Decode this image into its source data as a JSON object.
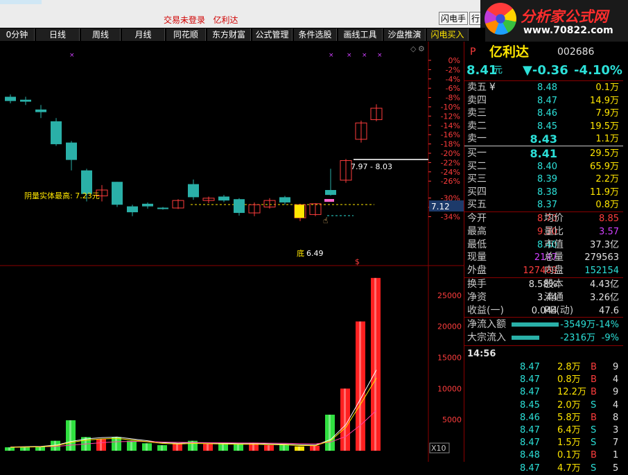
{
  "top": {
    "trade_status": "交易未登录",
    "stock_name": "亿利达",
    "flash_btn": "闪电手",
    "more_btn": "行"
  },
  "logo": {
    "brand": "分析家公式网",
    "url": "www.70822.com"
  },
  "toolbar": {
    "items": [
      "0分钟",
      "日线",
      "周线",
      "月线",
      "同花顺",
      "东方财富",
      "公式管理",
      "条件选股",
      "画线工具",
      "沙盘推演",
      "闪电买入"
    ],
    "active_index": 10
  },
  "chart_data": {
    "type": "candlestick",
    "price_axis_pct": [
      "0%",
      "-2%",
      "-4%",
      "-6%",
      "-8%",
      "-10%",
      "-12%",
      "-14%",
      "-16%",
      "-18%",
      "-20%",
      "-22%",
      "-24%",
      "-26%",
      "-30%",
      "-32%",
      "-34%"
    ],
    "price_range": [
      7.12,
      12.8
    ],
    "current_price_label": "7.12",
    "annotation_body_high": "阴量实体最高: 7.23元",
    "annotation_range": "7.97 - 8.03",
    "annotation_low": "6.49",
    "annotation_low_prefix": "底",
    "dollar_mark": "$",
    "volume_axis": [
      "25000",
      "20000",
      "15000",
      "10000",
      "5000"
    ],
    "volume_max": 27000,
    "volume_multiplier": "X10",
    "candles": [
      {
        "o": 11.75,
        "h": 11.82,
        "l": 11.55,
        "c": 11.62
      },
      {
        "o": 11.66,
        "h": 11.75,
        "l": 11.5,
        "c": 11.6
      },
      {
        "o": 11.36,
        "h": 11.5,
        "l": 11.1,
        "c": 11.28
      },
      {
        "o": 11.0,
        "h": 11.1,
        "l": 10.25,
        "c": 10.3
      },
      {
        "o": 10.35,
        "h": 10.4,
        "l": 9.5,
        "c": 9.82
      },
      {
        "o": 9.5,
        "h": 9.55,
        "l": 8.55,
        "c": 8.78
      },
      {
        "o": 8.72,
        "h": 9.05,
        "l": 8.55,
        "c": 8.9
      },
      {
        "o": 9.15,
        "h": 9.15,
        "l": 8.38,
        "c": 8.45
      },
      {
        "o": 8.4,
        "h": 8.45,
        "l": 8.1,
        "c": 8.22
      },
      {
        "o": 8.48,
        "h": 8.52,
        "l": 8.33,
        "c": 8.4
      },
      {
        "o": 8.36,
        "h": 8.38,
        "l": 8.3,
        "c": 8.33
      },
      {
        "o": 8.35,
        "h": 8.62,
        "l": 8.32,
        "c": 8.58
      },
      {
        "o": 9.08,
        "h": 9.22,
        "l": 8.6,
        "c": 8.68
      },
      {
        "o": 8.58,
        "h": 8.7,
        "l": 8.5,
        "c": 8.65
      },
      {
        "o": 8.7,
        "h": 8.75,
        "l": 8.53,
        "c": 8.58
      },
      {
        "o": 8.62,
        "h": 8.65,
        "l": 8.12,
        "c": 8.2
      },
      {
        "o": 8.2,
        "h": 8.52,
        "l": 8.1,
        "c": 8.45
      },
      {
        "o": 8.38,
        "h": 8.65,
        "l": 8.33,
        "c": 8.58
      },
      {
        "o": 8.68,
        "h": 8.72,
        "l": 8.45,
        "c": 8.52
      },
      {
        "o": 8.05,
        "h": 8.48,
        "l": 7.95,
        "c": 8.45
      },
      {
        "o": 8.15,
        "h": 8.5,
        "l": 8.1,
        "c": 8.48
      },
      {
        "o": 8.9,
        "h": 9.55,
        "l": 8.73,
        "c": 8.75
      },
      {
        "o": 9.2,
        "h": 9.85,
        "l": 9.12,
        "c": 9.8
      },
      {
        "o": 10.45,
        "h": 11.02,
        "l": 10.35,
        "c": 10.95
      },
      {
        "o": 11.05,
        "h": 11.52,
        "l": 11.0,
        "c": 11.4
      }
    ],
    "volumes": [
      550,
      620,
      700,
      1600,
      4900,
      2200,
      1900,
      2200,
      1600,
      1200,
      900,
      1150,
      1600,
      1100,
      1300,
      1100,
      1300,
      900,
      1000,
      700,
      800,
      5800,
      10000,
      20800,
      27800
    ],
    "ma_volume": [
      600,
      650,
      700,
      900,
      1500,
      1900,
      2100,
      2200,
      1900,
      1600,
      1300,
      1200,
      1300,
      1250,
      1200,
      1150,
      1150,
      1100,
      1050,
      950,
      900,
      1800,
      4200,
      8500,
      13000
    ],
    "ma_volume2": [
      580,
      600,
      640,
      700,
      900,
      1100,
      1300,
      1450,
      1500,
      1480,
      1400,
      1350,
      1320,
      1300,
      1280,
      1260,
      1240,
      1220,
      1200,
      1150,
      1100,
      1400,
      2300,
      4200,
      6500
    ],
    "marker_positions": [
      2,
      19,
      22,
      23,
      24
    ]
  },
  "quote": {
    "prefix": "P",
    "name": "亿利达",
    "code": "002686",
    "price": "8.41",
    "price_unit": "元",
    "change": "▼-0.36",
    "change_pct": "-4.10%",
    "asks": [
      {
        "label": "卖五",
        "price": "8.48",
        "vol": "0.1万",
        "mark": "¥"
      },
      {
        "label": "卖四",
        "price": "8.47",
        "vol": "14.9万"
      },
      {
        "label": "卖三",
        "price": "8.46",
        "vol": "7.9万"
      },
      {
        "label": "卖二",
        "price": "8.45",
        "vol": "19.5万"
      },
      {
        "label": "卖一",
        "price": "8.43",
        "vol": "1.1万"
      }
    ],
    "bids": [
      {
        "label": "买一",
        "price": "8.41",
        "vol": "29.5万"
      },
      {
        "label": "买二",
        "price": "8.40",
        "vol": "65.9万"
      },
      {
        "label": "买三",
        "price": "8.39",
        "vol": "2.2万"
      },
      {
        "label": "买四",
        "price": "8.38",
        "vol": "11.9万"
      },
      {
        "label": "买五",
        "price": "8.37",
        "vol": "0.8万"
      }
    ],
    "stats": [
      {
        "l1": "今开",
        "v1": "8.70",
        "c1": "c-red",
        "l2": "均价",
        "v2": "8.85",
        "c2": "c-red"
      },
      {
        "l1": "最高",
        "v1": "9.30",
        "c1": "c-red",
        "l2": "量比",
        "v2": "3.57",
        "c2": "c-mag"
      },
      {
        "l1": "最低",
        "v1": "8.40",
        "c1": "c-cyan",
        "l2": "市值",
        "v2": "37.3亿",
        "c2": "c-white"
      },
      {
        "l1": "现量",
        "v1": "2147",
        "c1": "c-mag",
        "l2": "总量",
        "v2": "279563",
        "c2": "c-white"
      },
      {
        "l1": "外盘",
        "v1": "127409",
        "c1": "c-red",
        "l2": "内盘",
        "v2": "152154",
        "c2": "c-cyan"
      }
    ],
    "fin": [
      {
        "l1": "换手",
        "v1": "8.58%",
        "l2": "股本",
        "v2": "4.43亿"
      },
      {
        "l1": "净资",
        "v1": "3.44",
        "l2": "流通",
        "v2": "3.26亿"
      },
      {
        "l1": "收益(一)",
        "v1": "0.044",
        "l2": "PE(动)",
        "v2": "47.6"
      }
    ],
    "flows": [
      {
        "label": "净流入额",
        "value": "-3549万",
        "pct": "-14%",
        "bar": 0.38
      },
      {
        "label": "大宗流入",
        "value": "-2316万",
        "pct": "-9%",
        "bar": 0.22
      }
    ],
    "time": "14:56",
    "ticks": [
      {
        "price": "8.47",
        "vol": "2.8万",
        "side": "B",
        "n": "9"
      },
      {
        "price": "8.47",
        "vol": "0.8万",
        "side": "B",
        "n": "4"
      },
      {
        "price": "8.47",
        "vol": "12.2万",
        "side": "B",
        "n": "9"
      },
      {
        "price": "8.45",
        "vol": "2.0万",
        "side": "S",
        "n": "4"
      },
      {
        "price": "8.46",
        "vol": "5.8万",
        "side": "B",
        "n": "8"
      },
      {
        "price": "8.47",
        "vol": "6.4万",
        "side": "S",
        "n": "3"
      },
      {
        "price": "8.47",
        "vol": "1.5万",
        "side": "S",
        "n": "7"
      },
      {
        "price": "8.48",
        "vol": "0.1万",
        "side": "B",
        "n": "1"
      },
      {
        "price": "8.47",
        "vol": "4.7万",
        "side": "S",
        "n": "5"
      }
    ]
  }
}
